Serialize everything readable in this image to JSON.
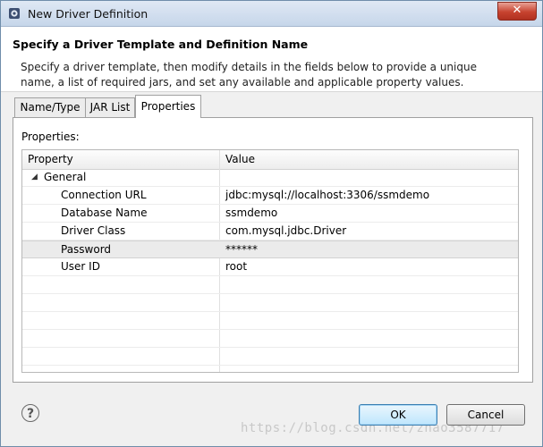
{
  "window": {
    "title": "New Driver Definition",
    "close_glyph": "✕"
  },
  "header": {
    "title": "Specify a Driver Template and Definition Name",
    "description": "Specify a driver template, then modify details in the fields below to provide a unique name, a list of required jars, and set any available and applicable property values."
  },
  "tabs": [
    {
      "label": "Name/Type"
    },
    {
      "label": "JAR List"
    },
    {
      "label": "Properties",
      "active": true
    }
  ],
  "properties_panel": {
    "label": "Properties:",
    "columns": [
      "Property",
      "Value"
    ],
    "group": {
      "label": "General",
      "expander": "◢"
    },
    "rows": [
      {
        "property": "Connection URL",
        "value": "jdbc:mysql://localhost:3306/ssmdemo"
      },
      {
        "property": "Database Name",
        "value": "ssmdemo"
      },
      {
        "property": "Driver Class",
        "value": "com.mysql.jdbc.Driver"
      },
      {
        "property": "Password",
        "value": "******",
        "selected": true
      },
      {
        "property": "User ID",
        "value": "root"
      }
    ]
  },
  "footer": {
    "help_glyph": "?",
    "ok_label": "OK",
    "cancel_label": "Cancel"
  },
  "watermark": "https://blog.csdn.net/zhao3587717"
}
